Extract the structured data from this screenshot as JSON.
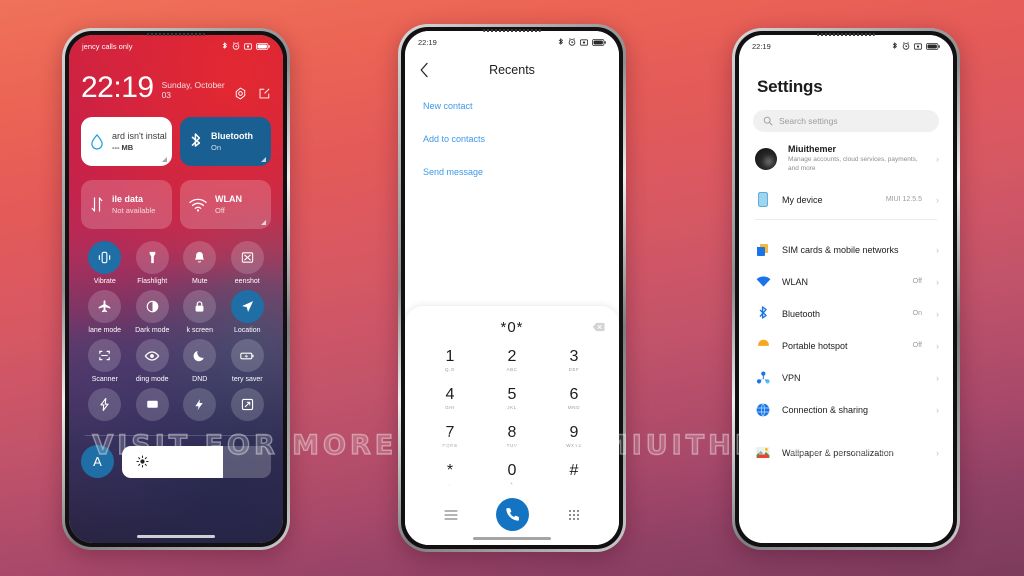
{
  "watermark": "VISIT FOR MORE THEMES - MIUITHEMER.COM",
  "lockscreen": {
    "statusbar": {
      "carrier": "jency calls only",
      "icons": [
        "bluetooth-icon",
        "alarm-icon",
        "vibrate-icon",
        "battery-icon"
      ]
    },
    "clock": {
      "time": "22:19",
      "date": "Sunday, October 03"
    },
    "clock_icons": [
      "settings-gear-icon",
      "edit-icon"
    ],
    "big_cards": [
      {
        "name": "storage",
        "title": "ard isn't instal",
        "sub": "--- MB",
        "style": "white",
        "icon": "water-drop-icon"
      },
      {
        "name": "bluetooth",
        "title": "Bluetooth",
        "sub": "On",
        "style": "blue",
        "icon": "bluetooth-icon"
      },
      {
        "name": "mobile-data",
        "title": "ile data",
        "sub": "Not available",
        "style": "glass",
        "icon": "data-arrows-icon"
      },
      {
        "name": "wlan",
        "title": "WLAN",
        "sub": "Off",
        "style": "glass",
        "icon": "wifi-icon"
      }
    ],
    "toggles": [
      {
        "label": "Vibrate",
        "icon": "vibrate-icon",
        "on": true
      },
      {
        "label": "Flashlight",
        "icon": "flashlight-icon",
        "on": false
      },
      {
        "label": "Mute",
        "icon": "bell-icon",
        "on": false
      },
      {
        "label": "eenshot",
        "icon": "screenshot-icon",
        "on": false
      },
      {
        "label": "lane mode",
        "icon": "airplane-icon",
        "on": false
      },
      {
        "label": "Dark mode",
        "icon": "darkmode-icon",
        "on": false
      },
      {
        "label": "k screen",
        "icon": "lock-icon",
        "on": false
      },
      {
        "label": "Location",
        "icon": "location-icon",
        "on": true
      },
      {
        "label": "Scanner",
        "icon": "scanner-icon",
        "on": false
      },
      {
        "label": "ding mode",
        "icon": "eye-icon",
        "on": false
      },
      {
        "label": "DND",
        "icon": "moon-icon",
        "on": false
      },
      {
        "label": "tery saver",
        "icon": "battery-saver-icon",
        "on": false
      },
      {
        "label": "",
        "icon": "lightning-icon",
        "on": false
      },
      {
        "label": "",
        "icon": "cast-icon",
        "on": false
      },
      {
        "label": "",
        "icon": "ultra-battery-icon",
        "on": false
      },
      {
        "label": "",
        "icon": "sync-icon",
        "on": false
      }
    ],
    "brightness": {
      "auto_label": "A",
      "icon": "sun-icon",
      "level_percent": 68
    }
  },
  "dialer": {
    "statusbar": {
      "time": "22:19",
      "icons": [
        "bluetooth-icon",
        "alarm-icon",
        "vibrate-icon",
        "battery-icon"
      ]
    },
    "title": "Recents",
    "back_icon": "chevron-left-icon",
    "links": [
      "New contact",
      "Add to contacts",
      "Send message"
    ],
    "number": "*0*",
    "delete_icon": "backspace-icon",
    "keys": [
      {
        "digit": "1",
        "sub": "Q,O"
      },
      {
        "digit": "2",
        "sub": "ABC"
      },
      {
        "digit": "3",
        "sub": "DEF"
      },
      {
        "digit": "4",
        "sub": "GHI"
      },
      {
        "digit": "5",
        "sub": "JKL"
      },
      {
        "digit": "6",
        "sub": "MNO"
      },
      {
        "digit": "7",
        "sub": "PQRS"
      },
      {
        "digit": "8",
        "sub": "TUV"
      },
      {
        "digit": "9",
        "sub": "WXYZ"
      },
      {
        "digit": "*",
        "sub": ","
      },
      {
        "digit": "0",
        "sub": "+"
      },
      {
        "digit": "#",
        "sub": ""
      }
    ],
    "bottom": {
      "menu_icon": "menu-icon",
      "call_icon": "phone-call-icon",
      "keypad_icon": "keypad-icon"
    }
  },
  "settings": {
    "statusbar": {
      "time": "22:19",
      "icons": [
        "bluetooth-icon",
        "alarm-icon",
        "vibrate-icon",
        "battery-icon"
      ]
    },
    "title": "Settings",
    "search": {
      "placeholder": "Search settings",
      "icon": "search-icon"
    },
    "account": {
      "name": "Miuithemer",
      "subtitle": "Manage accounts, cloud services, payments, and more",
      "chevron": "›"
    },
    "items": [
      {
        "label": "My device",
        "value": "MIUI 12.5.5",
        "icon": "device-icon",
        "group": 1
      },
      {
        "label": "SIM cards & mobile networks",
        "value": "",
        "icon": "sim-icon",
        "group": 2
      },
      {
        "label": "WLAN",
        "value": "Off",
        "icon": "wifi-icon",
        "group": 2
      },
      {
        "label": "Bluetooth",
        "value": "On",
        "icon": "bluetooth-icon",
        "group": 2
      },
      {
        "label": "Portable hotspot",
        "value": "Off",
        "icon": "hotspot-icon",
        "group": 2
      },
      {
        "label": "VPN",
        "value": "",
        "icon": "vpn-icon",
        "group": 2
      },
      {
        "label": "Connection & sharing",
        "value": "",
        "icon": "globe-icon",
        "group": 2
      },
      {
        "label": "Wallpaper & personalization",
        "value": "",
        "icon": "wallpaper-icon",
        "group": 3
      }
    ],
    "chevron": "›"
  },
  "colors": {
    "accent_blue": "#1574c1",
    "link_blue": "#3d9ae8",
    "card_blue": "#1a5f91",
    "bg_top": "#ef7259",
    "bg_bottom": "#7c3c5c"
  }
}
